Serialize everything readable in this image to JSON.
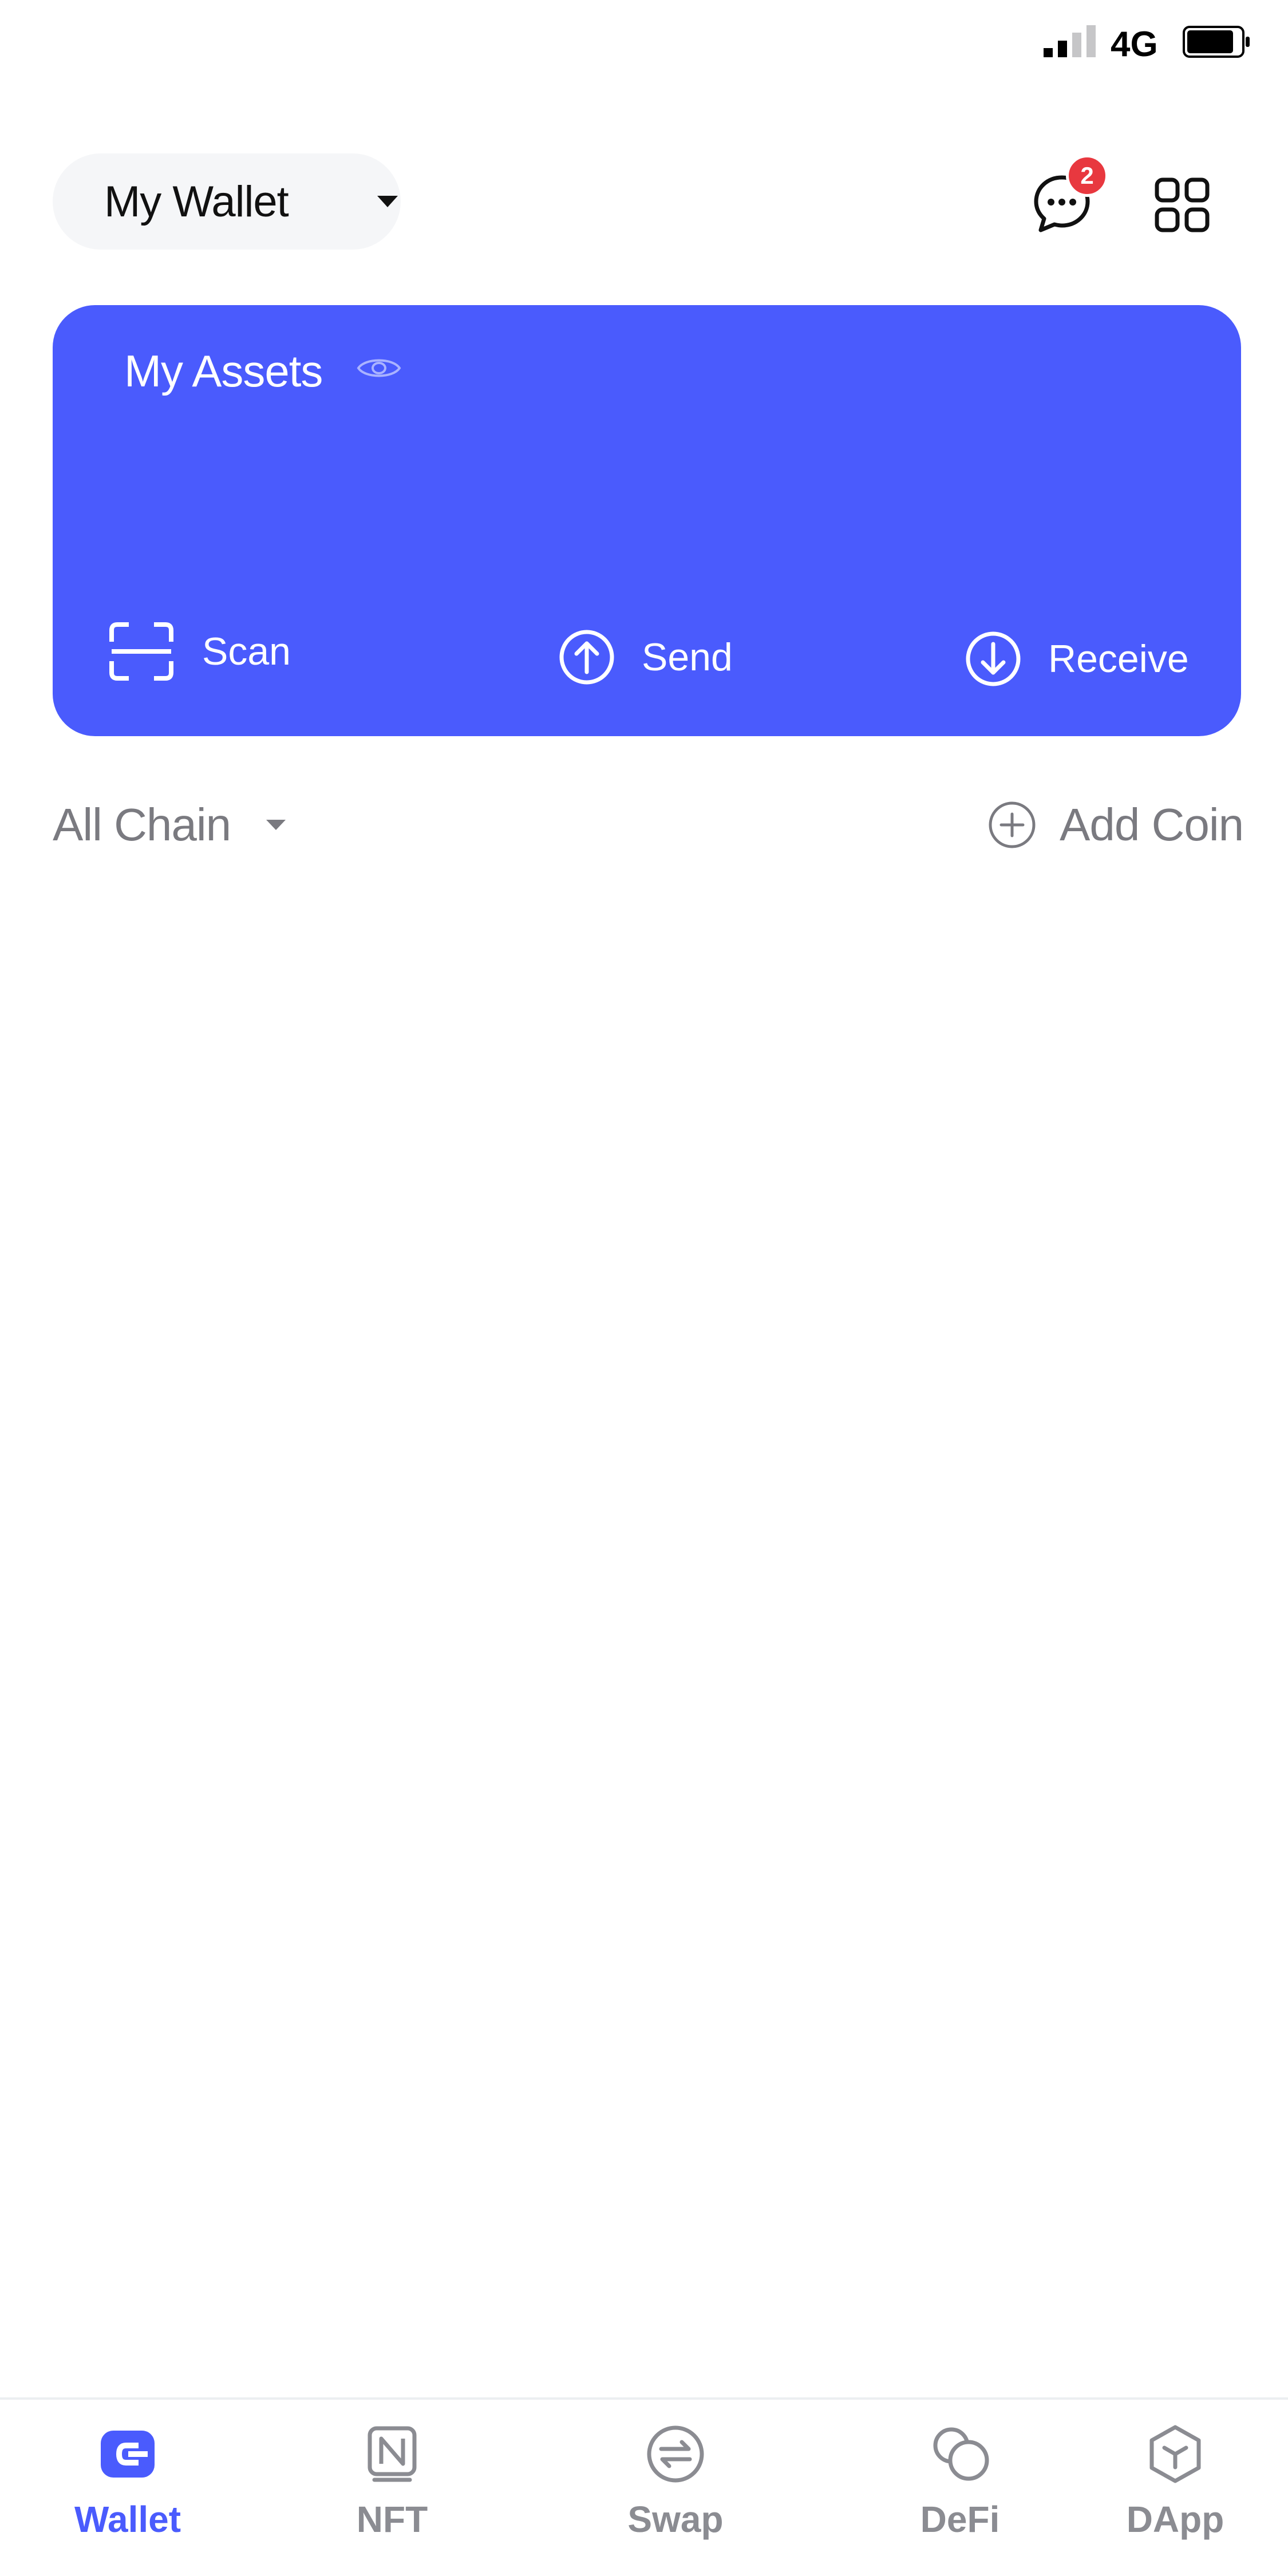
{
  "status_bar": {
    "network": "4G",
    "signal_bars_filled": 2,
    "signal_bars_total": 4,
    "battery_level": 0.85
  },
  "header": {
    "wallet_name": "My Wallet",
    "message_badge_count": "2"
  },
  "assets_card": {
    "title": "My Assets",
    "background_color": "#4a5bfd",
    "actions": {
      "scan": "Scan",
      "send": "Send",
      "receive": "Receive"
    }
  },
  "filter_row": {
    "chain_filter": "All Chain",
    "add_coin": "Add Coin"
  },
  "bottom_nav": {
    "active": "Wallet",
    "active_color": "#4a5bfd",
    "items": [
      {
        "label": "Wallet",
        "icon": "wallet-icon"
      },
      {
        "label": "NFT",
        "icon": "nft-icon"
      },
      {
        "label": "Swap",
        "icon": "swap-icon"
      },
      {
        "label": "DeFi",
        "icon": "defi-icon"
      },
      {
        "label": "DApp",
        "icon": "dapp-icon"
      }
    ]
  }
}
